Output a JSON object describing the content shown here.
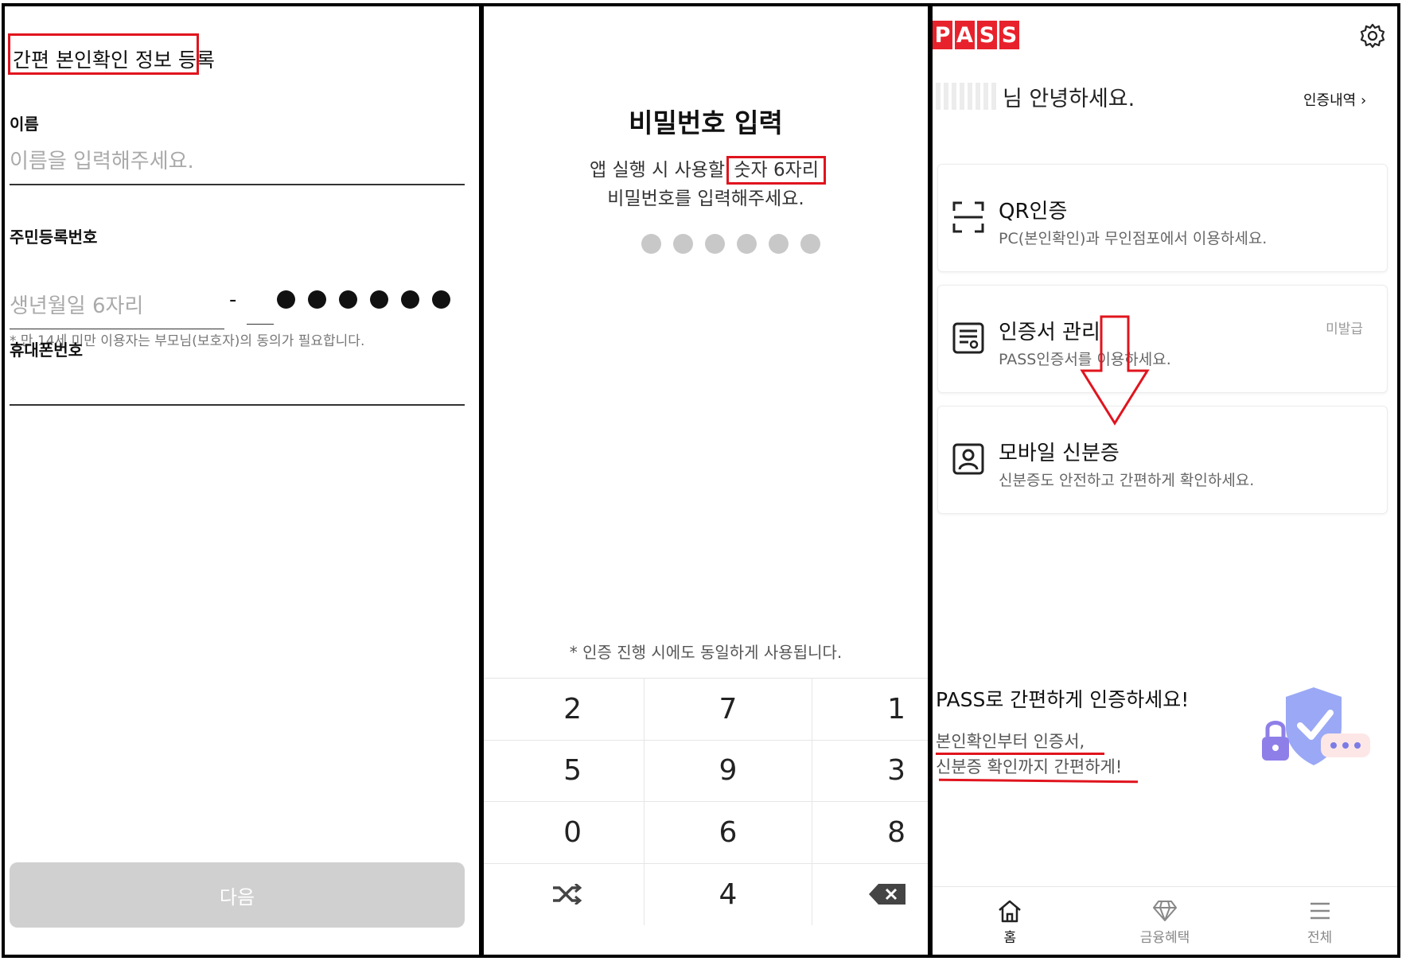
{
  "panel1": {
    "title": "간편 본인확인 정보 등록",
    "name_label": "이름",
    "name_placeholder": "이름을 입력해주세요.",
    "rrn_label": "주민등록번호",
    "rrn_front_placeholder": "생년월일 6자리",
    "rrn_dash": "-",
    "rrn_note": "* 만 14세 미만 이용자는 부모님(보호자)의 동의가 필요합니다.",
    "phone_label": "휴대폰번호",
    "next_button": "다음"
  },
  "panel2": {
    "title": "비밀번호 입력",
    "desc_prefix": "앱 실행 시 사용할 ",
    "desc_highlight": "숫자 6자리",
    "desc_line2": "비밀번호를 입력해주세요.",
    "note": "* 인증 진행 시에도 동일하게 사용됩니다.",
    "keypad": [
      "2",
      "7",
      "1",
      "5",
      "9",
      "3",
      "0",
      "6",
      "8",
      "shuffle-icon",
      "4",
      "backspace-icon"
    ]
  },
  "panel3": {
    "logo": [
      "P",
      "A",
      "S",
      "S"
    ],
    "greeting": "님 안녕하세요.",
    "history_link": "인증내역 ›",
    "cards": [
      {
        "title": "QR인증",
        "sub": "PC(본인확인)과 무인점포에서 이용하세요.",
        "icon": "qr-scan-icon",
        "badge": ""
      },
      {
        "title": "인증서 관리",
        "sub": "PASS인증서를 이용하세요.",
        "icon": "certificate-icon",
        "badge": "미발급"
      },
      {
        "title": "모바일 신분증",
        "sub": "신분증도 안전하고 간편하게 확인하세요.",
        "icon": "id-card-icon",
        "badge": ""
      }
    ],
    "promo_title": "PASS로 간편하게 인증하세요!",
    "promo_line1": "본인확인부터 인증서,",
    "promo_line2": "신분증 확인까지 간편하게!",
    "tabs": [
      {
        "label": "홈",
        "icon": "home-icon"
      },
      {
        "label": "금융혜택",
        "icon": "diamond-icon"
      },
      {
        "label": "전체",
        "icon": "menu-icon"
      }
    ],
    "colors": {
      "brand": "#e8222c",
      "annotation": "#e0141e"
    }
  }
}
